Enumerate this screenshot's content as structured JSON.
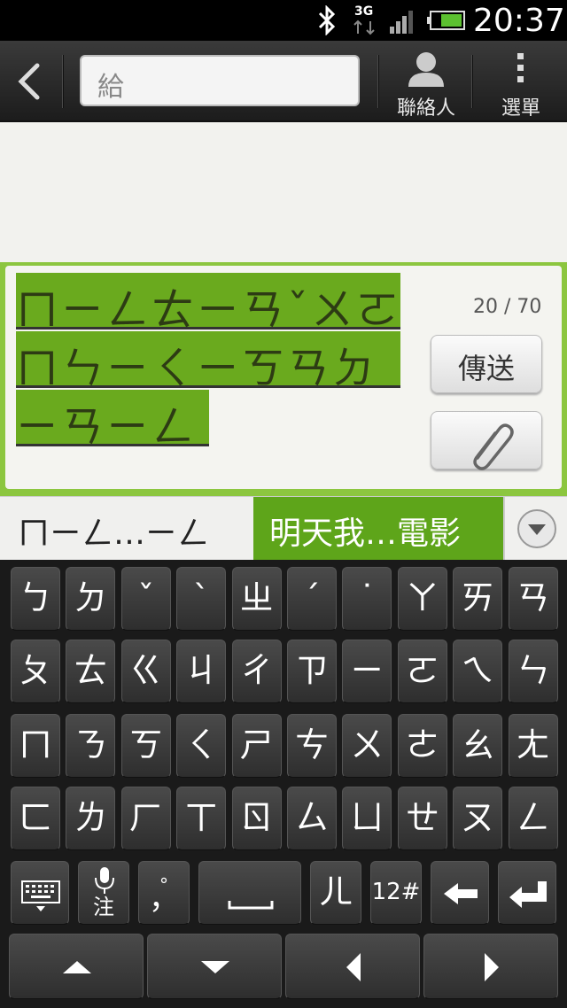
{
  "status_bar": {
    "time": "20:37",
    "network": "3G",
    "icons": [
      "bluetooth-icon",
      "3g-data-icon",
      "signal-icon",
      "battery-icon"
    ]
  },
  "action_bar": {
    "to_placeholder": "給",
    "contacts_label": "聯絡人",
    "menu_label": "選單"
  },
  "compose": {
    "lines": [
      "ㄇㄧㄥㄊㄧㄢˇㄨㄛ",
      "ㄇㄣㄧㄑㄧㄎㄢㄉ",
      "ㄧㄢㄧㄥ"
    ],
    "counter": "20 / 70",
    "send_label": "傳送"
  },
  "suggestions": {
    "first": "ㄇㄧㄥ…ㄧㄥ",
    "second": "明天我…電影"
  },
  "keyboard": {
    "rows": [
      [
        "ㄅ",
        "ㄉ",
        "ˇ",
        "ˋ",
        "ㄓ",
        "ˊ",
        "˙",
        "ㄚ",
        "ㄞ",
        "ㄢ"
      ],
      [
        "ㄆ",
        "ㄊ",
        "ㄍ",
        "ㄐ",
        "ㄔ",
        "ㄗ",
        "ㄧ",
        "ㄛ",
        "ㄟ",
        "ㄣ"
      ],
      [
        "ㄇ",
        "ㄋ",
        "ㄎ",
        "ㄑ",
        "ㄕ",
        "ㄘ",
        "ㄨ",
        "ㄜ",
        "ㄠ",
        "ㄤ"
      ],
      [
        "ㄈ",
        "ㄌ",
        "ㄏ",
        "ㄒ",
        "ㄖ",
        "ㄙ",
        "ㄩ",
        "ㄝ",
        "ㄡ",
        "ㄥ"
      ]
    ],
    "mic_label": "注",
    "punct_label": "，",
    "er_label": "ㄦ",
    "num_label": "12#"
  },
  "colors": {
    "accent_green": "#6aaa1e",
    "suggest_green": "#5ea51a",
    "key_bg": "#3a3a3a"
  }
}
